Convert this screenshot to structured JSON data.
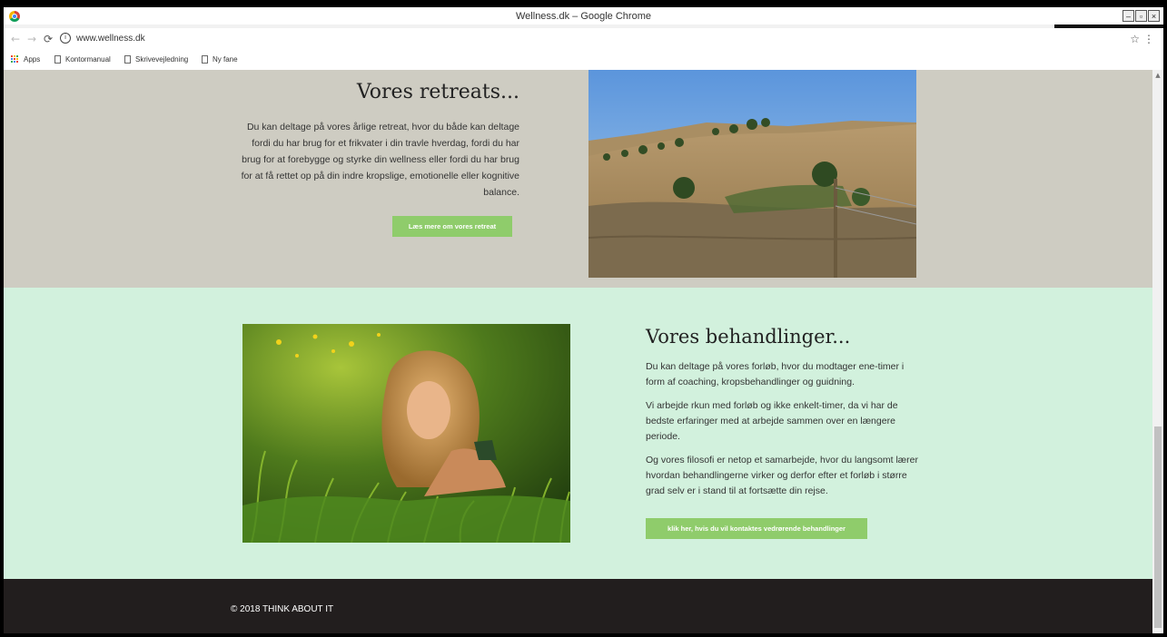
{
  "browser": {
    "window_title": "Wellness.dk – Google Chrome",
    "url": "www.wellness.dk",
    "window_buttons": [
      "–",
      "▫",
      "×"
    ],
    "bookmarks": [
      {
        "label": "Apps",
        "icon": "apps-grid-icon"
      },
      {
        "label": "Kontormanual",
        "icon": "page-icon"
      },
      {
        "label": "Skrivevejledning",
        "icon": "page-icon"
      },
      {
        "label": "Ny fane",
        "icon": "page-icon"
      }
    ]
  },
  "retreats": {
    "title": "Vores retreats...",
    "text": "Du kan deltage på vores årlige retreat, hvor du både kan deltage fordi du har brug for et frikvater i din travle hverdag, fordi du har brug for at forebygge og styrke din wellness eller fordi du har brug for at få rettet op på din indre kropslige, emotionelle eller kognitive balance.",
    "button": "Læs mere om vores retreat"
  },
  "treatments": {
    "title": "Vores behandlinger...",
    "paragraphs": [
      "Du kan deltage på vores forløb, hvor du modtager ene-timer i form af coaching, kropsbehandlinger og guidning.",
      "Vi arbejde rkun med forløb og ikke enkelt-timer, da vi har de bedste erfaringer med at arbejde sammen over en længere periode.",
      "Og vores filosofi er netop et samarbejde, hvor du langsomt lærer hvordan behandlingerne virker og derfor efter et forløb i større grad selv er i stand til at fortsætte din rejse."
    ],
    "button": "klik her, hvis du vil kontaktes vedrørende behandlinger"
  },
  "footer": {
    "text": "© 2018 THINK ABOUT IT"
  },
  "colors": {
    "retreat_bg": "#ceccc2",
    "treatment_bg": "#d2f1dd",
    "button_green": "#8fcc6b",
    "footer_bg": "#221e1e"
  }
}
